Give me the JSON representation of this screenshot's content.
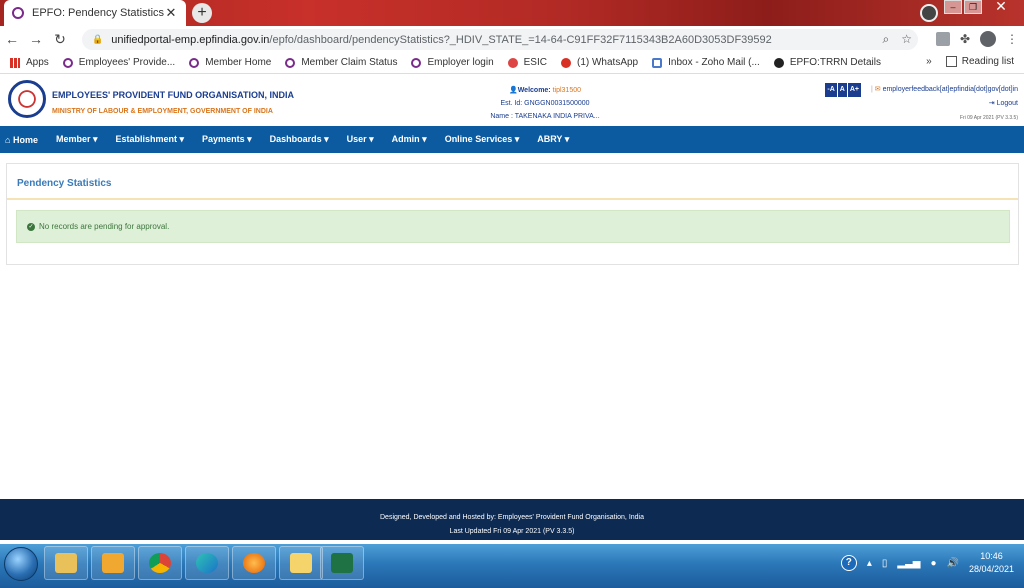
{
  "browser": {
    "tab_title": "EPFO: Pendency Statistics",
    "tab_close": "✕",
    "new_tab": "+",
    "url_host": "unifiedportal-emp.epfindia.gov.in",
    "url_path": "/epfo/dashboard/pendencyStatistics?_HDIV_STATE_=14-64-C91FF32F7115343B2A60D3053DF39592",
    "back": "←",
    "forward": "→",
    "reload": "↻"
  },
  "bookmarks": {
    "items": [
      {
        "label": "Apps",
        "icon": "apps-icon"
      },
      {
        "label": "Employees' Provide...",
        "icon": "epfo-icon"
      },
      {
        "label": "Member Home",
        "icon": "epfo-icon"
      },
      {
        "label": "Member Claim Status",
        "icon": "epfo-icon"
      },
      {
        "label": "Employer login",
        "icon": "epfo-icon"
      },
      {
        "label": "ESIC",
        "icon": "esic-icon"
      },
      {
        "label": "(1) WhatsApp",
        "icon": "whatsapp-icon"
      },
      {
        "label": "Inbox - Zoho Mail (...",
        "icon": "zoho-icon"
      },
      {
        "label": "EPFO:TRRN Details",
        "icon": "epfo-trrn-icon"
      }
    ],
    "overflow": "»",
    "reading_list": "Reading list"
  },
  "header": {
    "org_name": "EMPLOYEES' PROVIDENT FUND ORGANISATION, INDIA",
    "ministry": "MINISTRY OF LABOUR & EMPLOYMENT, GOVERNMENT OF INDIA",
    "welcome_label": "Welcome:",
    "username": "tipl31500",
    "est_id": "Est. Id: GNGGN0031500000",
    "name": "Name : TAKENAKA INDIA PRIVA...",
    "font_sizes": [
      "-A",
      "A",
      "A+"
    ],
    "feedback_email": "employerfeedback[at]epfindia[dot]gov[dot]in",
    "logout": "Logout",
    "date_version": "Fri 09 Apr 2021 (PV 3.3.5)"
  },
  "nav": {
    "items": [
      {
        "label": "Home",
        "icon": "home-icon"
      },
      {
        "label": "Member ▾"
      },
      {
        "label": "Establishment ▾"
      },
      {
        "label": "Payments ▾"
      },
      {
        "label": "Dashboards ▾"
      },
      {
        "label": "User ▾"
      },
      {
        "label": "Admin ▾"
      },
      {
        "label": "Online Services ▾"
      },
      {
        "label": "ABRY ▾"
      }
    ]
  },
  "content": {
    "title": "Pendency Statistics",
    "alert": "No records are pending for approval."
  },
  "footer": {
    "line1": "Designed, Developed and Hosted by: Employees' Provident Fund Organisation, India",
    "line2": "Last Updated Fri 09 Apr 2021 (PV 3.3.5)"
  },
  "taskbar": {
    "time": "10:46",
    "date": "28/04/2021",
    "apps": [
      "explorer-icon",
      "outlook-icon",
      "chrome-icon",
      "edge-icon",
      "firefox-icon",
      "folder-icon",
      "excel-icon"
    ]
  },
  "colors": {
    "nav_bg": "#0c5ba0",
    "footer_bg": "#0d2a52",
    "alert_bg": "#dff0d8",
    "title_blue": "#3a7ab8",
    "accent_orange": "#d9751c"
  }
}
